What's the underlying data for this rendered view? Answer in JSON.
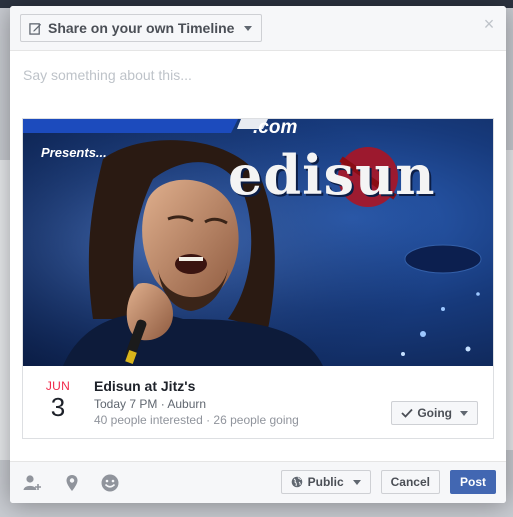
{
  "header": {
    "share_label": "Share on your own Timeline",
    "close_label": "×"
  },
  "composer": {
    "placeholder": "Say something about this..."
  },
  "cover": {
    "brand_text": ".com",
    "presents_text": "Presents...",
    "band_name": "edisun"
  },
  "event": {
    "month": "JUN",
    "day": "3",
    "title": "Edisun at Jitz's",
    "time": "Today 7 PM · Auburn",
    "stats": "40 people interested · 26 people going",
    "rsvp_label": "Going"
  },
  "footer": {
    "audience_label": "Public",
    "cancel_label": "Cancel",
    "post_label": "Post"
  },
  "colors": {
    "primary": "#4267b2",
    "date_month": "#f02849",
    "panel_bg": "#f6f7f9"
  }
}
